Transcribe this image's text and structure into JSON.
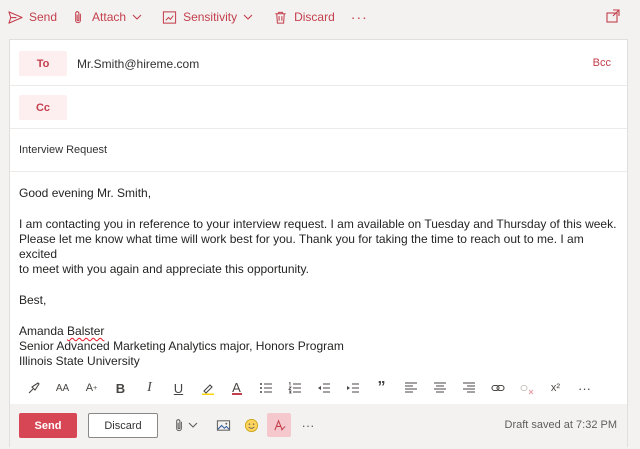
{
  "toolbar": {
    "send": "Send",
    "attach": "Attach",
    "sensitivity": "Sensitivity",
    "discard": "Discard",
    "more": "···",
    "icons": [
      "send-icon",
      "paperclip-icon",
      "sensitivity-icon",
      "trash-icon",
      "popout-icon"
    ]
  },
  "recipients": {
    "to_label": "To",
    "to_value": "Mr.Smith@hireme.com",
    "cc_label": "Cc",
    "bcc_label": "Bcc"
  },
  "subject": "Interview Request",
  "body": {
    "greeting": "Good evening Mr. Smith,",
    "paragraph_line1": "I am contacting you in reference to your interview request. I am available on Tuesday and Thursday of this week.",
    "paragraph_line2": "Please let me know what time will work best for you. Thank you for taking the time to reach out to me. I am excited",
    "paragraph_line3": "to meet with you again and appreciate this opportunity.",
    "closing": "Best,",
    "signature_first": "Amanda ",
    "signature_last": "Balster",
    "signature_title": "Senior Advanced Marketing Analytics major, Honors Program",
    "signature_school": "Illinois State University"
  },
  "format_toolbar": {
    "bold": "B",
    "italic": "I",
    "underline": "U",
    "quote": "”",
    "more": "···",
    "font_size_glyph": "AA",
    "grow_glyph": "A",
    "font_color_glyph": "A",
    "superscript_glyph": "x²"
  },
  "bottom": {
    "send": "Send",
    "discard": "Discard",
    "more": "···",
    "draft_status": "Draft saved at 7:32 PM"
  },
  "colors": {
    "accent": "#c43e4c",
    "send_button": "#d74654",
    "pill_bg": "#fdeff0"
  }
}
